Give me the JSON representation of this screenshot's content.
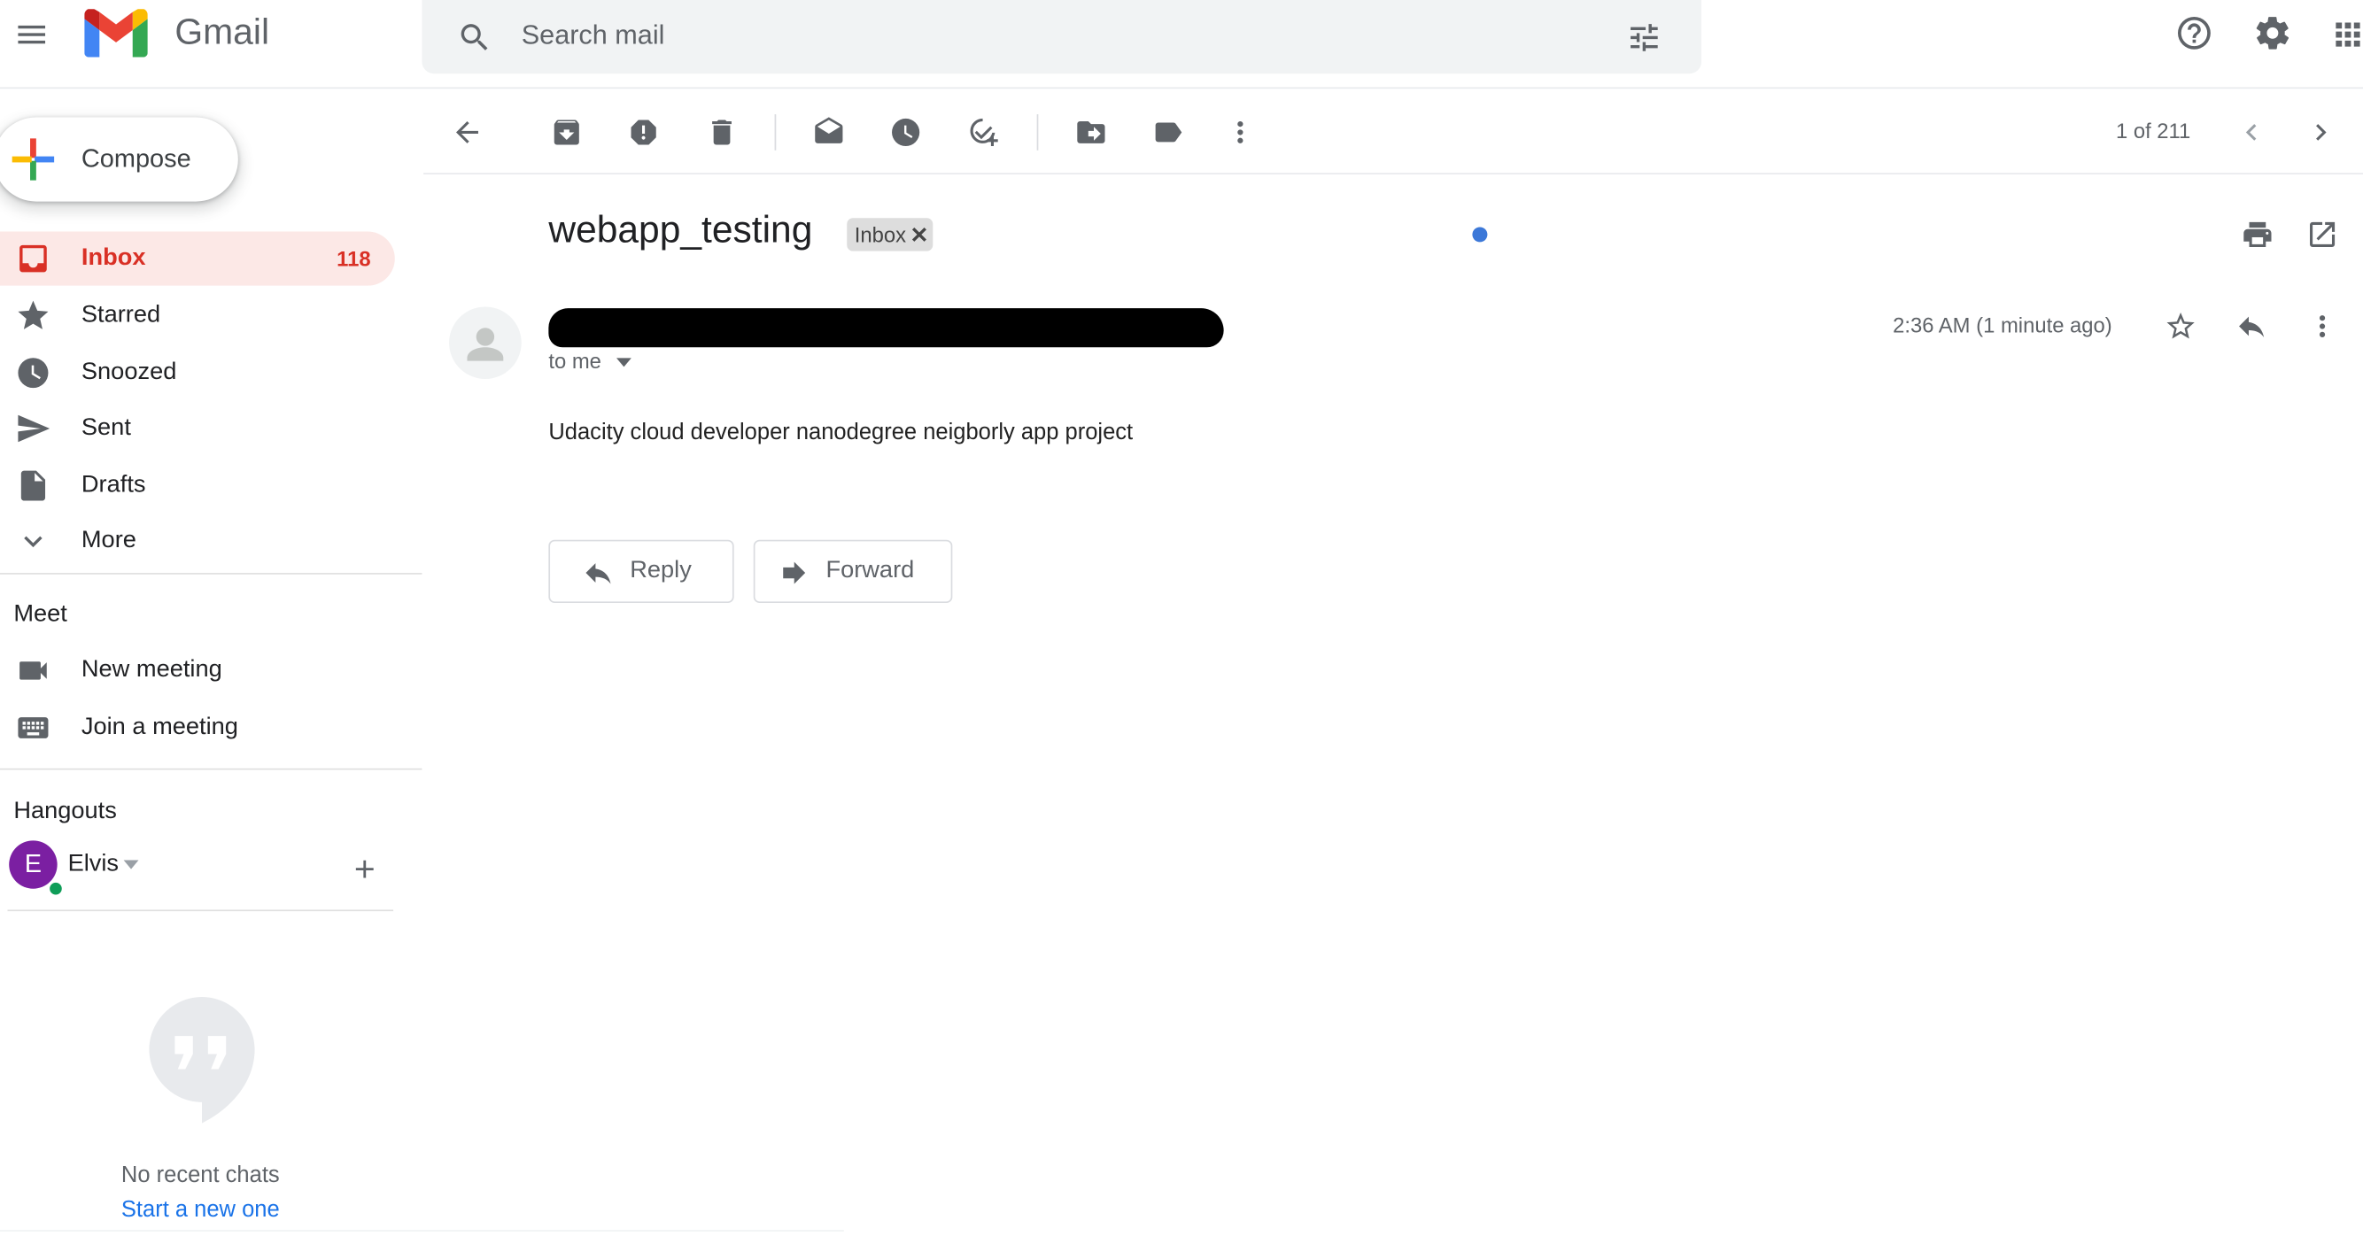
{
  "app": {
    "name": "Gmail"
  },
  "search": {
    "placeholder": "Search mail"
  },
  "compose": {
    "label": "Compose"
  },
  "nav": {
    "items": [
      {
        "label": "Inbox",
        "count": "118",
        "icon": "inbox-icon",
        "active": true
      },
      {
        "label": "Starred",
        "icon": "star-icon"
      },
      {
        "label": "Snoozed",
        "icon": "clock-icon"
      },
      {
        "label": "Sent",
        "icon": "send-icon"
      },
      {
        "label": "Drafts",
        "icon": "draft-icon"
      },
      {
        "label": "More",
        "icon": "chevron-down-icon"
      }
    ]
  },
  "meet": {
    "title": "Meet",
    "items": [
      {
        "label": "New meeting",
        "icon": "video-camera-icon"
      },
      {
        "label": "Join a meeting",
        "icon": "keyboard-icon"
      }
    ]
  },
  "hangouts": {
    "title": "Hangouts",
    "user": {
      "initial": "E",
      "name": "Elvis",
      "avatar_color": "#7b1fa2",
      "status_color": "#0f9d58"
    },
    "empty_text": "No recent chats",
    "start_link": "Start a new one"
  },
  "toolbar": {
    "pagination": "1 of 211",
    "actions": [
      "back-icon",
      "archive-icon",
      "report-spam-icon",
      "delete-icon",
      "mark-unread-icon",
      "snooze-icon",
      "add-to-tasks-icon",
      "move-to-icon",
      "label-icon",
      "more-icon"
    ]
  },
  "message": {
    "subject": "webapp_testing",
    "label_chip": "Inbox",
    "recipient": "to me",
    "time": "2:36 AM (1 minute ago)",
    "body": "Udacity cloud developer nanodegree neigborly app project"
  },
  "reply": {
    "reply_label": "Reply",
    "forward_label": "Forward"
  },
  "colors": {
    "accent_red": "#d93025",
    "active_bg": "#fce8e6",
    "link_blue": "#1a73e8",
    "unread_dot": "#3c78d8"
  }
}
